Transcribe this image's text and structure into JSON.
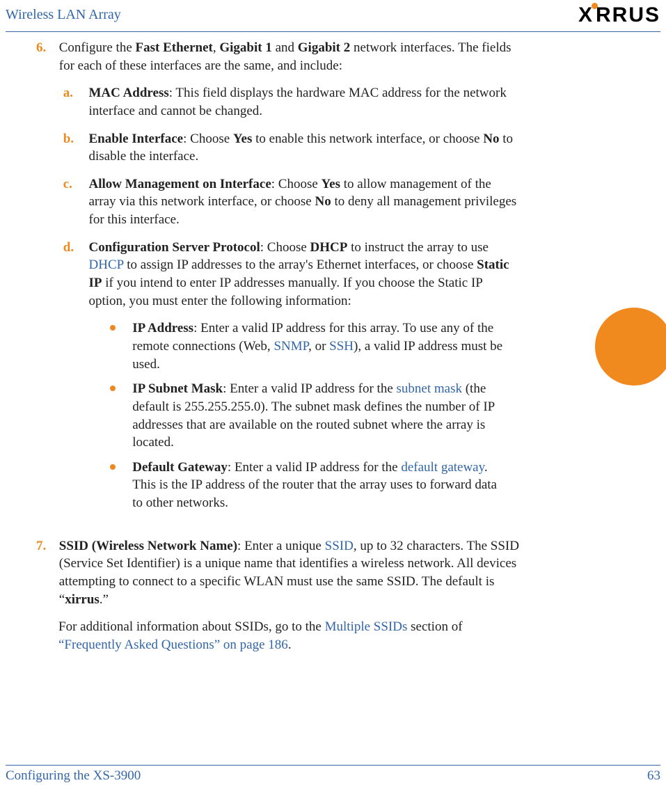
{
  "header": {
    "title": "Wireless LAN Array",
    "logo_text": "XIRRUS"
  },
  "side_marker": {
    "type": "circle",
    "color": "#f08a1f"
  },
  "step6": {
    "marker": "6.",
    "intro_pre": "Configure the ",
    "bold1": "Fast Ethernet",
    "sep1": ", ",
    "bold2": "Gigabit 1",
    "sep2": " and ",
    "bold3": "Gigabit 2",
    "intro_post": " network interfaces. The fields for each of these interfaces are the same, and include:",
    "a": {
      "marker": "a.",
      "bold": "MAC Address",
      "text": ": This field displays the hardware MAC address for the network interface and cannot be changed."
    },
    "b": {
      "marker": "b.",
      "bold": "Enable Interface",
      "t1": ": Choose ",
      "yes": "Yes",
      "t2": " to enable this network interface, or choose ",
      "no": "No",
      "t3": " to disable the interface."
    },
    "c": {
      "marker": "c.",
      "bold": "Allow Management on Interface",
      "t1": ": Choose ",
      "yes": "Yes",
      "t2": " to allow management of the array via this network interface, or choose ",
      "no": "No",
      "t3": " to deny all management privileges for this interface."
    },
    "d": {
      "marker": "d.",
      "bold": "Configuration Server Protocol",
      "t1": ": Choose ",
      "dhcp_bold": "DHCP",
      "t2": " to instruct the array to use ",
      "dhcp_link": "DHCP",
      "t3": " to assign IP addresses to the array's Ethernet interfaces, or choose ",
      "static_bold": "Static IP",
      "t4": " if you intend to enter IP addresses manually. If you choose the Static IP option, you must enter the following information:",
      "bul1": {
        "bold": "IP Address",
        "t1": ": Enter a valid IP address for this array. To use any of the remote connections (Web, ",
        "snmp": "SNMP",
        "t2": ", or ",
        "ssh": "SSH",
        "t3": "), a valid IP address must be used."
      },
      "bul2": {
        "bold": "IP Subnet Mask",
        "t1": ": Enter a valid IP address for the ",
        "link1": "subnet mask",
        "t2": " (the default is 255.255.255.0). The subnet mask defines the number of IP addresses that are available on the routed subnet where the array is located."
      },
      "bul3": {
        "bold": "Default Gateway",
        "t1": ": Enter a valid IP address for the ",
        "link1": "default gateway",
        "t2": ". This is the IP address of the router that the array uses to forward data to other networks."
      }
    }
  },
  "step7": {
    "marker": "7.",
    "bold": "SSID (Wireless Network Name)",
    "t1": ": Enter a unique ",
    "ssid_link": "SSID",
    "t2": ", up to 32 characters. The SSID (Service Set Identifier) is a unique name that identifies a wireless network. All devices attempting to connect to a specific WLAN must use the same SSID. The default is “",
    "default_bold": "xirrus",
    "t3": ".”",
    "p2_t1": "For additional information about SSIDs, go to the ",
    "p2_link1": "Multiple SSIDs",
    "p2_t2": " section of ",
    "p2_link2": "“Frequently Asked Questions” on page 186",
    "p2_t3": "."
  },
  "footer": {
    "section": "Configuring the XS-3900",
    "page": "63"
  }
}
